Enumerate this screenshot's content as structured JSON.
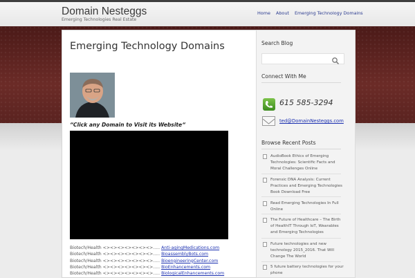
{
  "site": {
    "title": "Domain Nesteggs",
    "tagline": "Emerging Technologies Real Estate"
  },
  "nav": {
    "items": [
      "Home",
      "About",
      "Emerging Technology Domains"
    ]
  },
  "main": {
    "title": "Emerging Technology Domains",
    "quote": "“Click any Domain to Visit its Website“",
    "domains": [
      {
        "category": "Biotech/Health <><><><><><><>.....",
        "domain": "Anti-agingMedications.com"
      },
      {
        "category": "Biotech/Health <><><><><><><>.....",
        "domain": "BioassemblyBots.com"
      },
      {
        "category": "Biotech/Health <><><><><><><>.....",
        "domain": "BioengineeringCenter.com"
      },
      {
        "category": "Biotech/Health <><><><><><><>.....",
        "domain": "BioEnhancements.com"
      },
      {
        "category": "Biotech/Health <><><><><><><>.....",
        "domain": "BiologicalEnhancements.com"
      }
    ]
  },
  "sidebar": {
    "search_heading": "Search Blog",
    "search_placeholder": "",
    "connect_heading": "Connect With Me",
    "phone": "615 585-3294",
    "email": "ted@DomainNesteggs.com",
    "recent_heading": "Browse Recent Posts",
    "recent_posts": [
      "AudioBook Ethics of Emerging Technologies: Scientific Facts and Moral Challenges Online",
      "Forensic DNA Analysis: Current Practices and Emerging Technologies Book Download Free",
      "Read Emerging Technologies In Full Online",
      "The Future of Healthcare – The Birth of HealthIT Through IoT, Wearables and Emerging Technologies",
      "Future technologies and new technology 2015_2016. That Will Change The World",
      "5 future battery technologies for your phone"
    ]
  },
  "colors": {
    "link": "#1a2fb0",
    "nav": "#2a3a8f",
    "band": "#5a2320",
    "phone_icon": "#5aa832"
  },
  "icons": [
    "search-icon",
    "phone-icon",
    "mail-icon",
    "document-icon"
  ]
}
